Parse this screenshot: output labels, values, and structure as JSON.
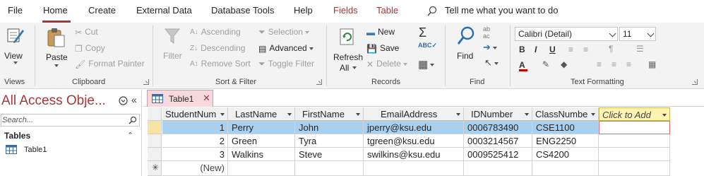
{
  "tabs": [
    {
      "label": "File"
    },
    {
      "label": "Home"
    },
    {
      "label": "Create"
    },
    {
      "label": "External Data"
    },
    {
      "label": "Database Tools"
    },
    {
      "label": "Help"
    },
    {
      "label": "Fields"
    },
    {
      "label": "Table"
    }
  ],
  "tell_me": "Tell me what you want to do",
  "ribbon": {
    "views": {
      "view_label": "View",
      "group": "Views"
    },
    "clipboard": {
      "paste": "Paste",
      "cut": "Cut",
      "copy": "Copy",
      "format_painter": "Format Painter",
      "group": "Clipboard"
    },
    "sort_filter": {
      "filter": "Filter",
      "ascending": "Ascending",
      "descending": "Descending",
      "remove_sort": "Remove Sort",
      "selection": "Selection",
      "advanced": "Advanced",
      "toggle_filter": "Toggle Filter",
      "group": "Sort & Filter"
    },
    "records": {
      "refresh": "Refresh",
      "refresh_all": "All",
      "new": "New",
      "save": "Save",
      "delete": "Delete",
      "group": "Records"
    },
    "find": {
      "find": "Find",
      "group": "Find"
    },
    "text_formatting": {
      "font": "Calibri (Detail)",
      "size": "11",
      "group": "Text Formatting"
    }
  },
  "nav": {
    "title": "All Access Obje...",
    "search_placeholder": "Search...",
    "section": "Tables",
    "items": [
      {
        "label": "Table1"
      }
    ]
  },
  "doc_tab": {
    "label": "Table1"
  },
  "table": {
    "columns": [
      "StudentNum",
      "LastName",
      "FirstName",
      "EmailAddress",
      "IDNumber",
      "ClassNumbe",
      "Click to Add"
    ],
    "rows": [
      {
        "StudentNum": "1",
        "LastName": "Perry",
        "FirstName": "John",
        "EmailAddress": "jperry@ksu.edu",
        "IDNumber": "0006783490",
        "ClassNumber": "CSE1100"
      },
      {
        "StudentNum": "2",
        "LastName": "Green",
        "FirstName": "Tyra",
        "EmailAddress": "tgreen@ksu.edu",
        "IDNumber": "0003214567",
        "ClassNumber": "ENG2250"
      },
      {
        "StudentNum": "3",
        "LastName": "Walkins",
        "FirstName": "Steve",
        "EmailAddress": "swilkins@ksu.edu",
        "IDNumber": "0009525412",
        "ClassNumber": "CS4200"
      }
    ],
    "new_row": "(New)"
  },
  "colors": {
    "accent": "#a4373a",
    "row_highlight": "#a9d0ee",
    "add_column": "#fff3b0"
  }
}
